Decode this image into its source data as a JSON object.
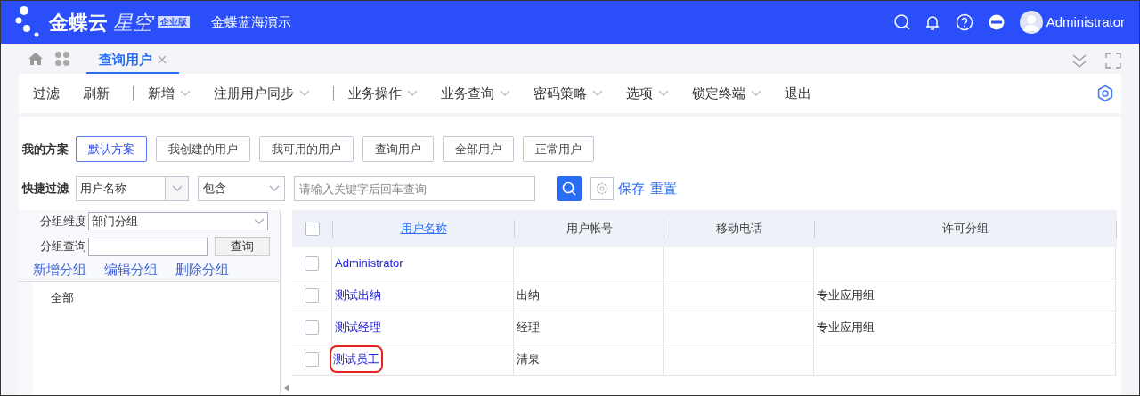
{
  "header": {
    "brand": "金蝶云",
    "product": "星空",
    "edition": "企业版",
    "org": "金蝶蓝海演示",
    "user": "Administrator"
  },
  "tabs": [
    {
      "label": "查询用户",
      "selected": true
    }
  ],
  "toolbar": [
    {
      "kind": "button",
      "label": "过滤",
      "dropdown": false
    },
    {
      "kind": "button",
      "label": "刷新",
      "dropdown": false
    },
    {
      "kind": "separator"
    },
    {
      "kind": "button",
      "label": "新增",
      "dropdown": true
    },
    {
      "kind": "button",
      "label": "注册用户同步",
      "dropdown": true
    },
    {
      "kind": "separator"
    },
    {
      "kind": "button",
      "label": "业务操作",
      "dropdown": true
    },
    {
      "kind": "button",
      "label": "业务查询",
      "dropdown": true
    },
    {
      "kind": "button",
      "label": "密码策略",
      "dropdown": true
    },
    {
      "kind": "button",
      "label": "选项",
      "dropdown": true
    },
    {
      "kind": "button",
      "label": "锁定终端",
      "dropdown": true
    },
    {
      "kind": "button",
      "label": "退出",
      "dropdown": false
    }
  ],
  "schemes": {
    "label": "我的方案",
    "items": [
      {
        "label": "默认方案",
        "selected": true
      },
      {
        "label": "我创建的用户",
        "selected": false
      },
      {
        "label": "我可用的用户",
        "selected": false
      },
      {
        "label": "查询用户",
        "selected": false
      },
      {
        "label": "全部用户",
        "selected": false
      },
      {
        "label": "正常用户",
        "selected": false
      }
    ]
  },
  "quick_filter": {
    "label": "快捷过滤",
    "field": "用户名称",
    "operator": "包含",
    "placeholder": "请输入关键字后回车查询",
    "save": "保存",
    "reset": "重置"
  },
  "group_panel": {
    "dimension_label": "分组维度",
    "dimension": "部门分组",
    "query_label": "分组查询",
    "query_button": "查询",
    "actions": [
      "新增分组",
      "编辑分组",
      "删除分组"
    ],
    "tree": [
      {
        "label": "全部"
      }
    ]
  },
  "table": {
    "select_all_checked": false,
    "columns": [
      "用户名称",
      "用户帐号",
      "移动电话",
      "许可分组"
    ],
    "rows": [
      {
        "cells": [
          "Administrator",
          "",
          "",
          ""
        ],
        "checked": false,
        "highlighted": false
      },
      {
        "cells": [
          "测试出纳",
          "出纳",
          "",
          "专业应用组"
        ],
        "checked": false,
        "highlighted": false
      },
      {
        "cells": [
          "测试经理",
          "经理",
          "",
          "专业应用组"
        ],
        "checked": false,
        "highlighted": false
      },
      {
        "cells": [
          "测试员工",
          "清泉",
          "",
          ""
        ],
        "checked": false,
        "highlighted": true
      }
    ]
  }
}
